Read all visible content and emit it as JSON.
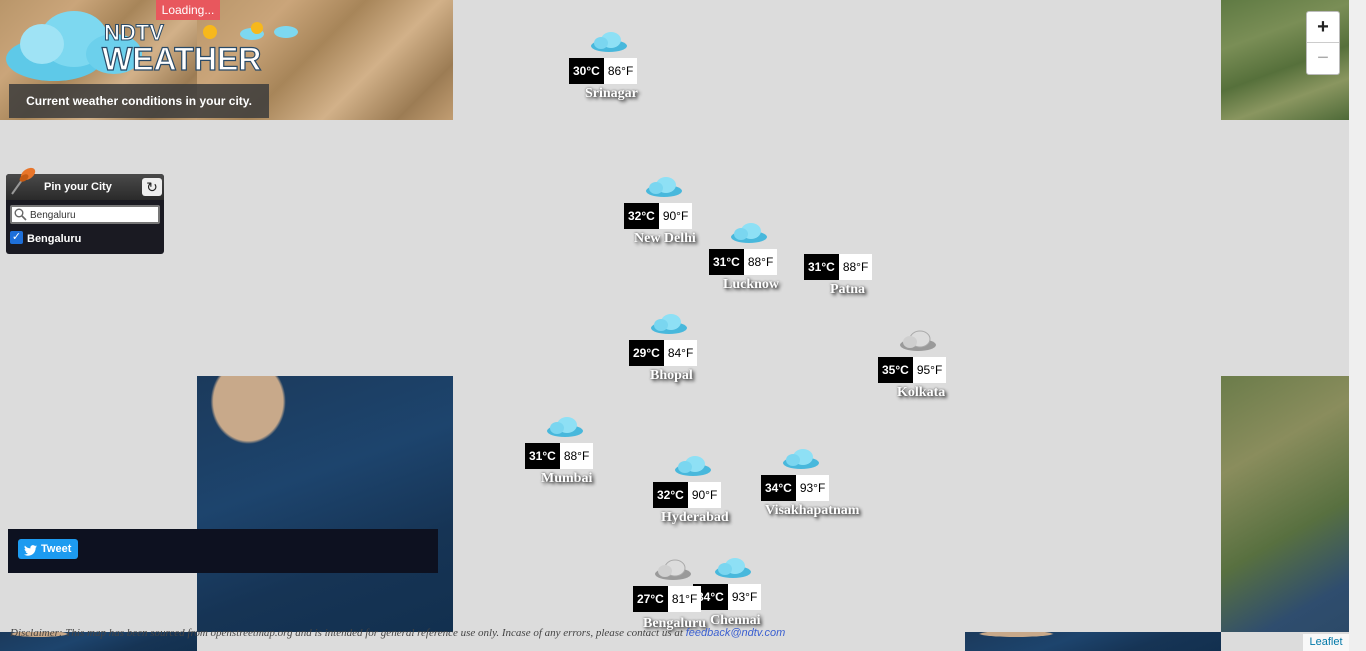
{
  "header": {
    "loading": "Loading...",
    "logo_text": "NDTV WEATHER",
    "tagline": "Current weather conditions in your city."
  },
  "pin_panel": {
    "title": "Pin your City",
    "search_value": "Bengaluru",
    "checked_city": "Bengaluru"
  },
  "tweet": {
    "label": "Tweet"
  },
  "zoom": {
    "in": "+",
    "out": "−"
  },
  "cities": [
    {
      "name": "Srinagar",
      "c": "30°C",
      "f": "86°F",
      "icon": "cloud-icon"
    },
    {
      "name": "New Delhi",
      "c": "32°C",
      "f": "90°F",
      "icon": "cloud-icon"
    },
    {
      "name": "Lucknow",
      "c": "31°C",
      "f": "88°F",
      "icon": "cloud-icon"
    },
    {
      "name": "Patna",
      "c": "31°C",
      "f": "88°F",
      "icon": "none"
    },
    {
      "name": "Bhopal",
      "c": "29°C",
      "f": "84°F",
      "icon": "cloud-icon"
    },
    {
      "name": "Kolkata",
      "c": "35°C",
      "f": "95°F",
      "icon": "grey-cloud-icon"
    },
    {
      "name": "Mumbai",
      "c": "31°C",
      "f": "88°F",
      "icon": "cloud-icon"
    },
    {
      "name": "Hyderabad",
      "c": "32°C",
      "f": "90°F",
      "icon": "cloud-icon"
    },
    {
      "name": "Visakhapatnam",
      "c": "34°C",
      "f": "93°F",
      "icon": "cloud-icon"
    },
    {
      "name": "Bengaluru",
      "c": "27°C",
      "f": "81°F",
      "icon": "grey-cloud-icon"
    },
    {
      "name": "Chennai",
      "c": "34°C",
      "f": "93°F",
      "icon": "cloud-icon"
    }
  ],
  "footer": {
    "disclaimer": "Disclaimer: This map has been sourced from openstreetmap.org and is intended for general reference use only. Incase of any errors, please contact us at ",
    "email": "feedback@ndtv.com",
    "attribution": "Leaflet"
  }
}
